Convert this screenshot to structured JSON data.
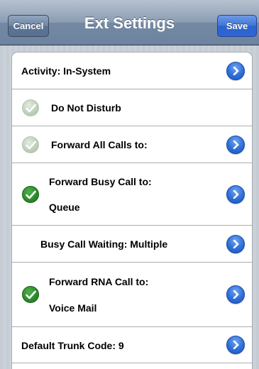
{
  "navbar": {
    "title": "Ext Settings",
    "cancel_label": "Cancel",
    "save_label": "Save"
  },
  "rows": [
    {
      "label": "Activity: In-System",
      "check": "none",
      "disclosure": true
    },
    {
      "label": "Do Not Disturb",
      "check": "off",
      "disclosure": false
    },
    {
      "label": "Forward All Calls to:",
      "check": "off",
      "disclosure": true
    },
    {
      "label": "Forward Busy Call to:",
      "value": "Queue",
      "check": "on",
      "disclosure": true
    },
    {
      "label": "Busy Call Waiting: Multiple",
      "check": "none",
      "disclosure": true
    },
    {
      "label": "Forward RNA Call to:",
      "value": "Voice Mail",
      "check": "on",
      "disclosure": true
    },
    {
      "label": "Default Trunk Code: 9",
      "check": "none",
      "disclosure": true
    }
  ],
  "colors": {
    "navbar": "#7489a2",
    "save_button": "#2f66d2",
    "check_on": "#2a8a2a",
    "check_off": "#bccdb8",
    "disclosure": "#2e6fd8"
  },
  "icons": {
    "check": "checkmark-icon",
    "disclosure": "chevron-right-icon"
  }
}
